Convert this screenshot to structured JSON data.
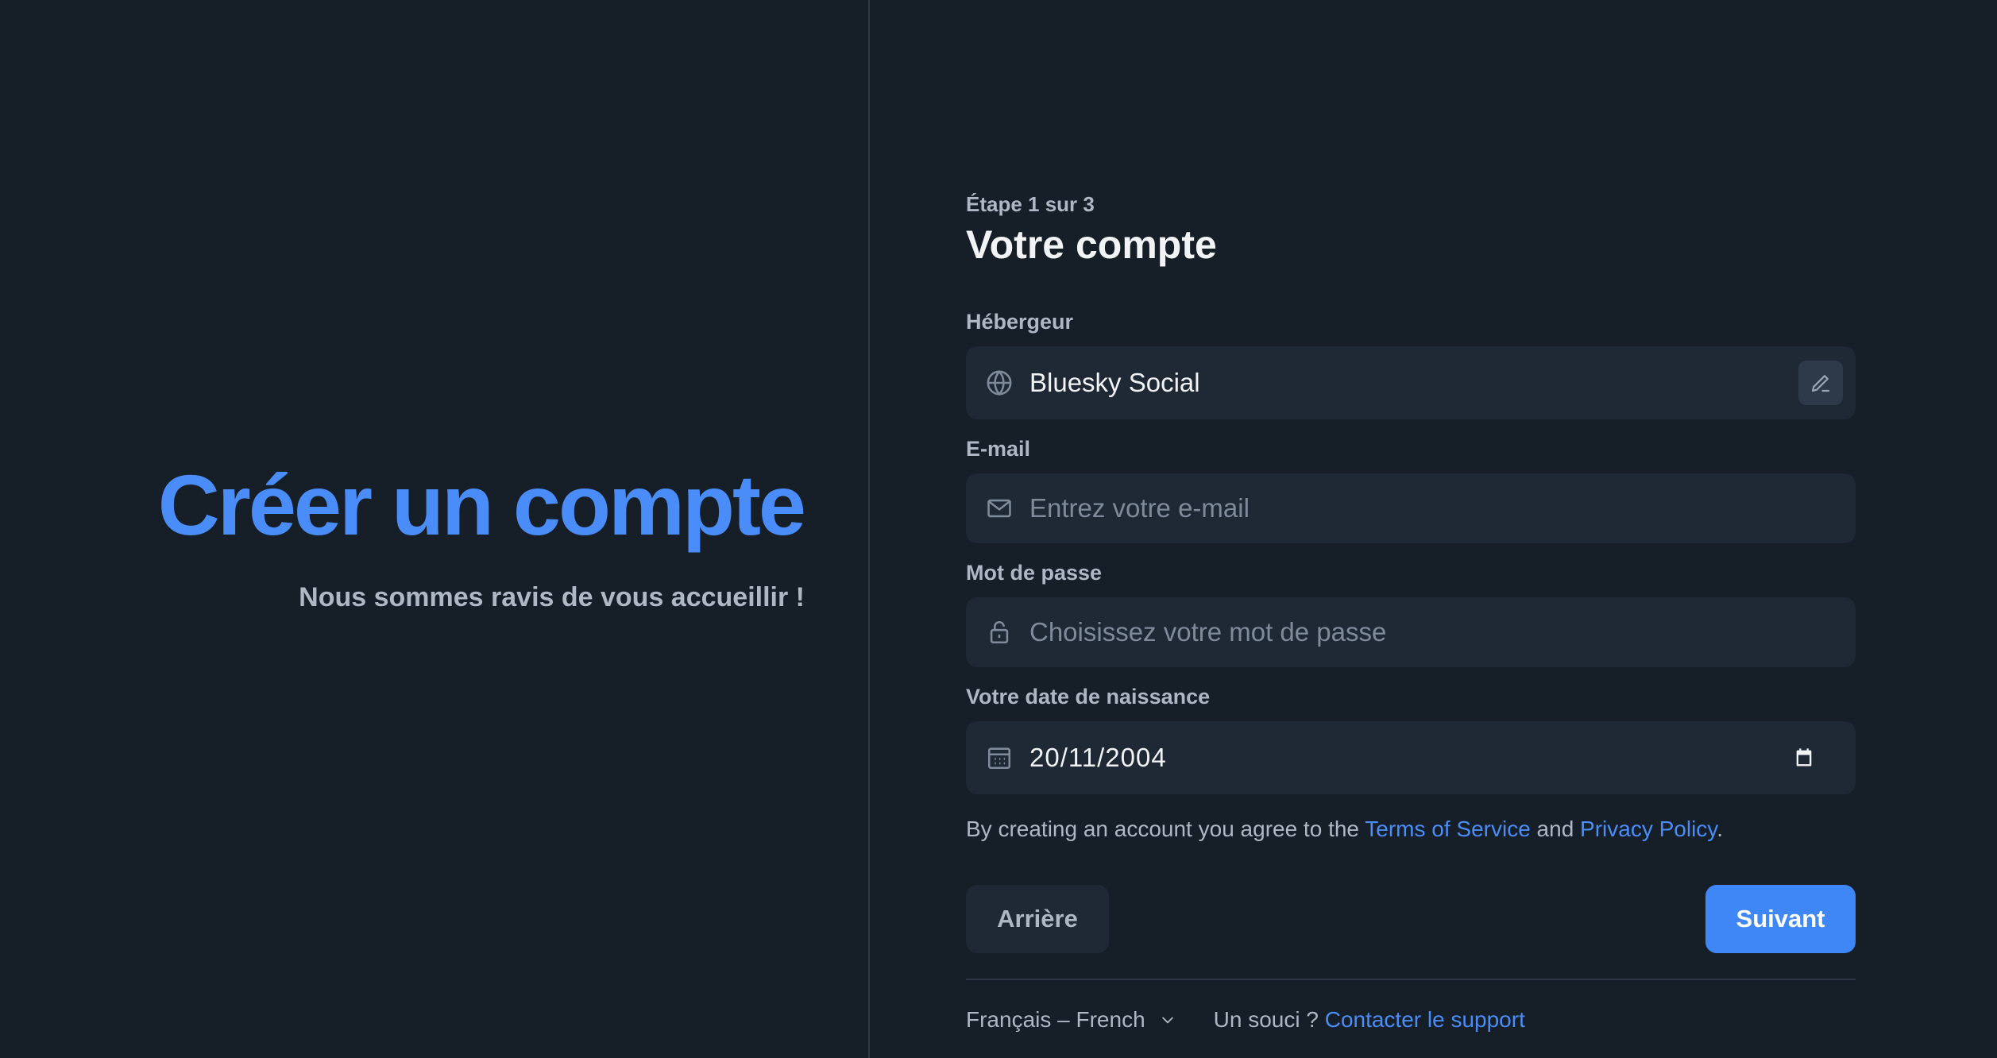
{
  "hero": {
    "title": "Créer un compte",
    "subtitle": "Nous sommes ravis de vous accueillir !"
  },
  "form": {
    "step": "Étape 1 sur 3",
    "title": "Votre compte",
    "host": {
      "label": "Hébergeur",
      "value": "Bluesky Social",
      "icon": "globe-icon",
      "edit_icon": "pencil-icon"
    },
    "email": {
      "label": "E-mail",
      "placeholder": "Entrez votre e-mail",
      "icon": "mail-icon"
    },
    "password": {
      "label": "Mot de passe",
      "placeholder": "Choisissez votre mot de passe",
      "icon": "lock-icon"
    },
    "birthdate": {
      "label": "Votre date de naissance",
      "value": "20/11/2004",
      "icon": "calendar-icon"
    },
    "terms": {
      "prefix": "By creating an account you agree to the ",
      "tos_link": "Terms of Service",
      "middle": " and ",
      "privacy_link": "Privacy Policy",
      "suffix": "."
    },
    "back_label": "Arrière",
    "next_label": "Suivant"
  },
  "footer": {
    "language": "Français – French",
    "support_prefix": "Un souci ? ",
    "support_link": "Contacter le support"
  },
  "colors": {
    "background": "#161e27",
    "field_background": "#1f2835",
    "accent": "#4a8df8",
    "primary_button": "#3f87f6",
    "muted_text": "#aeb8c5"
  }
}
